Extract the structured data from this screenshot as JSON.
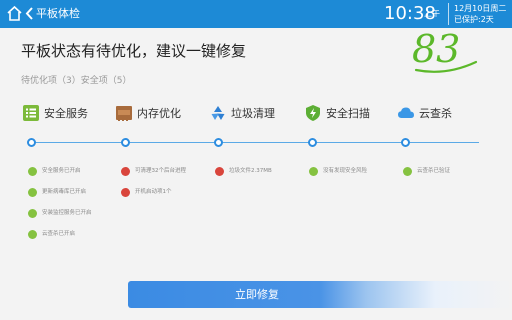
{
  "topbar": {
    "title": "平板体检",
    "time": "10:38",
    "ampm": "上午",
    "date_line1": "12月10日周二",
    "date_line2": "已保护:2天",
    "bg_color": "#1d8ad6"
  },
  "main": {
    "headline": "平板状态有待优化，建议一键修复",
    "score": "83",
    "pending": "待优化项（3）安全项（5）"
  },
  "categories": [
    {
      "label": "安全服务",
      "icon": "list-icon"
    },
    {
      "label": "内存优化",
      "icon": "ram-chip-icon"
    },
    {
      "label": "垃圾清理",
      "icon": "recycle-icon"
    },
    {
      "label": "安全扫描",
      "icon": "shield-icon"
    },
    {
      "label": "云查杀",
      "icon": "cloud-icon"
    }
  ],
  "items": {
    "col1": [
      {
        "status": "ok",
        "text": "安全服务已开启"
      },
      {
        "status": "ok",
        "text": "更新病毒库已开启"
      },
      {
        "status": "ok",
        "text": "安装监控服务已开启"
      },
      {
        "status": "ok",
        "text": "云查杀已开启"
      }
    ],
    "col2": [
      {
        "status": "warn",
        "text": "可清理32个后台进程"
      },
      {
        "status": "warn",
        "text": "开机启动项1个"
      }
    ],
    "col3": [
      {
        "status": "warn",
        "text": "垃圾文件2.37MB"
      }
    ],
    "col4": [
      {
        "status": "ok",
        "text": "没有发现安全风险"
      }
    ],
    "col5": [
      {
        "status": "ok",
        "text": "云查杀已验证"
      }
    ]
  },
  "fix_button": {
    "label": "立即修复"
  },
  "colors": {
    "accent": "#2d8de0",
    "ok": "#85c240",
    "warn": "#d9453c",
    "score": "#5cb82a"
  }
}
